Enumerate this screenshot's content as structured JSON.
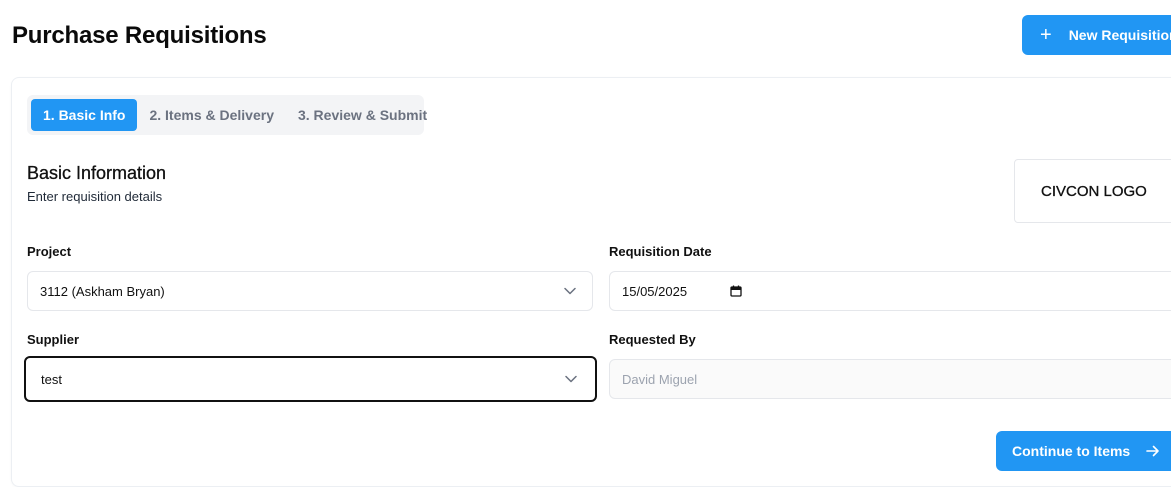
{
  "page": {
    "title": "Purchase Requisitions"
  },
  "header": {
    "new_button_label": "New Requisition",
    "new_button_icon": "plus-icon"
  },
  "tabs": [
    {
      "label": "1. Basic Info",
      "active": true
    },
    {
      "label": "2. Items & Delivery",
      "active": false
    },
    {
      "label": "3. Review & Submit",
      "active": false
    }
  ],
  "section": {
    "title": "Basic Information",
    "subtitle": "Enter requisition details",
    "logo_text": "CIVCON LOGO"
  },
  "form": {
    "project": {
      "label": "Project",
      "value": "3112 (Askham Bryan)"
    },
    "requisition_date": {
      "label": "Requisition Date",
      "value": "15/05/2025"
    },
    "supplier": {
      "label": "Supplier",
      "value": "test"
    },
    "requested_by": {
      "label": "Requested By",
      "value": "David Miguel"
    }
  },
  "footer": {
    "continue_label": "Continue to Items",
    "continue_icon": "arrow-right-icon"
  },
  "colors": {
    "primary": "#2196f3",
    "text": "#111111",
    "muted": "#6b7280"
  }
}
